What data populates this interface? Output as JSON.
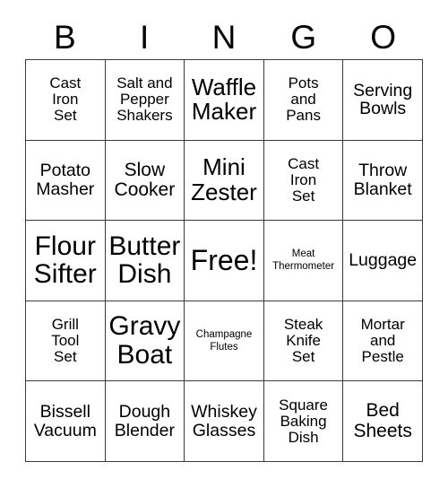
{
  "card": {
    "title": "BINGO",
    "header_letters": [
      "B",
      "I",
      "N",
      "G",
      "O"
    ],
    "columns": 5,
    "rows": 5,
    "free_space": {
      "row": 3,
      "column": 3,
      "label": "Free!"
    },
    "colors": {
      "background": "#ffffff",
      "text": "#000000",
      "grid_line": "#3a3a3a"
    },
    "rows_data": [
      [
        {
          "label": "Cast\nIron\nSet",
          "size": "s"
        },
        {
          "label": "Salt and\nPepper\nShakers",
          "size": "s"
        },
        {
          "label": "Waffle\nMaker",
          "size": "xl"
        },
        {
          "label": "Pots\nand\nPans",
          "size": "s"
        },
        {
          "label": "Serving\nBowls",
          "size": "m"
        }
      ],
      [
        {
          "label": "Potato\nMasher",
          "size": "m"
        },
        {
          "label": "Slow\nCooker",
          "size": "l"
        },
        {
          "label": "Mini\nZester",
          "size": "xl"
        },
        {
          "label": "Cast\nIron\nSet",
          "size": "s"
        },
        {
          "label": "Throw\nBlanket",
          "size": "m"
        }
      ],
      [
        {
          "label": "Flour\nSifter",
          "size": "xxl"
        },
        {
          "label": "Butter\nDish",
          "size": "xxl"
        },
        {
          "label": "Free!",
          "size": "free"
        },
        {
          "label": "Meat\nThermometer",
          "size": "xs"
        },
        {
          "label": "Luggage",
          "size": "m"
        }
      ],
      [
        {
          "label": "Grill\nTool\nSet",
          "size": "s"
        },
        {
          "label": "Gravy\nBoat",
          "size": "xxl"
        },
        {
          "label": "Champagne\nFlutes",
          "size": "xs"
        },
        {
          "label": "Steak\nKnife\nSet",
          "size": "s"
        },
        {
          "label": "Mortar\nand\nPestle",
          "size": "s"
        }
      ],
      [
        {
          "label": "Bissell\nVacuum",
          "size": "m"
        },
        {
          "label": "Dough\nBlender",
          "size": "m"
        },
        {
          "label": "Whiskey\nGlasses",
          "size": "m"
        },
        {
          "label": "Square\nBaking\nDish",
          "size": "s"
        },
        {
          "label": "Bed\nSheets",
          "size": "l"
        }
      ]
    ]
  }
}
